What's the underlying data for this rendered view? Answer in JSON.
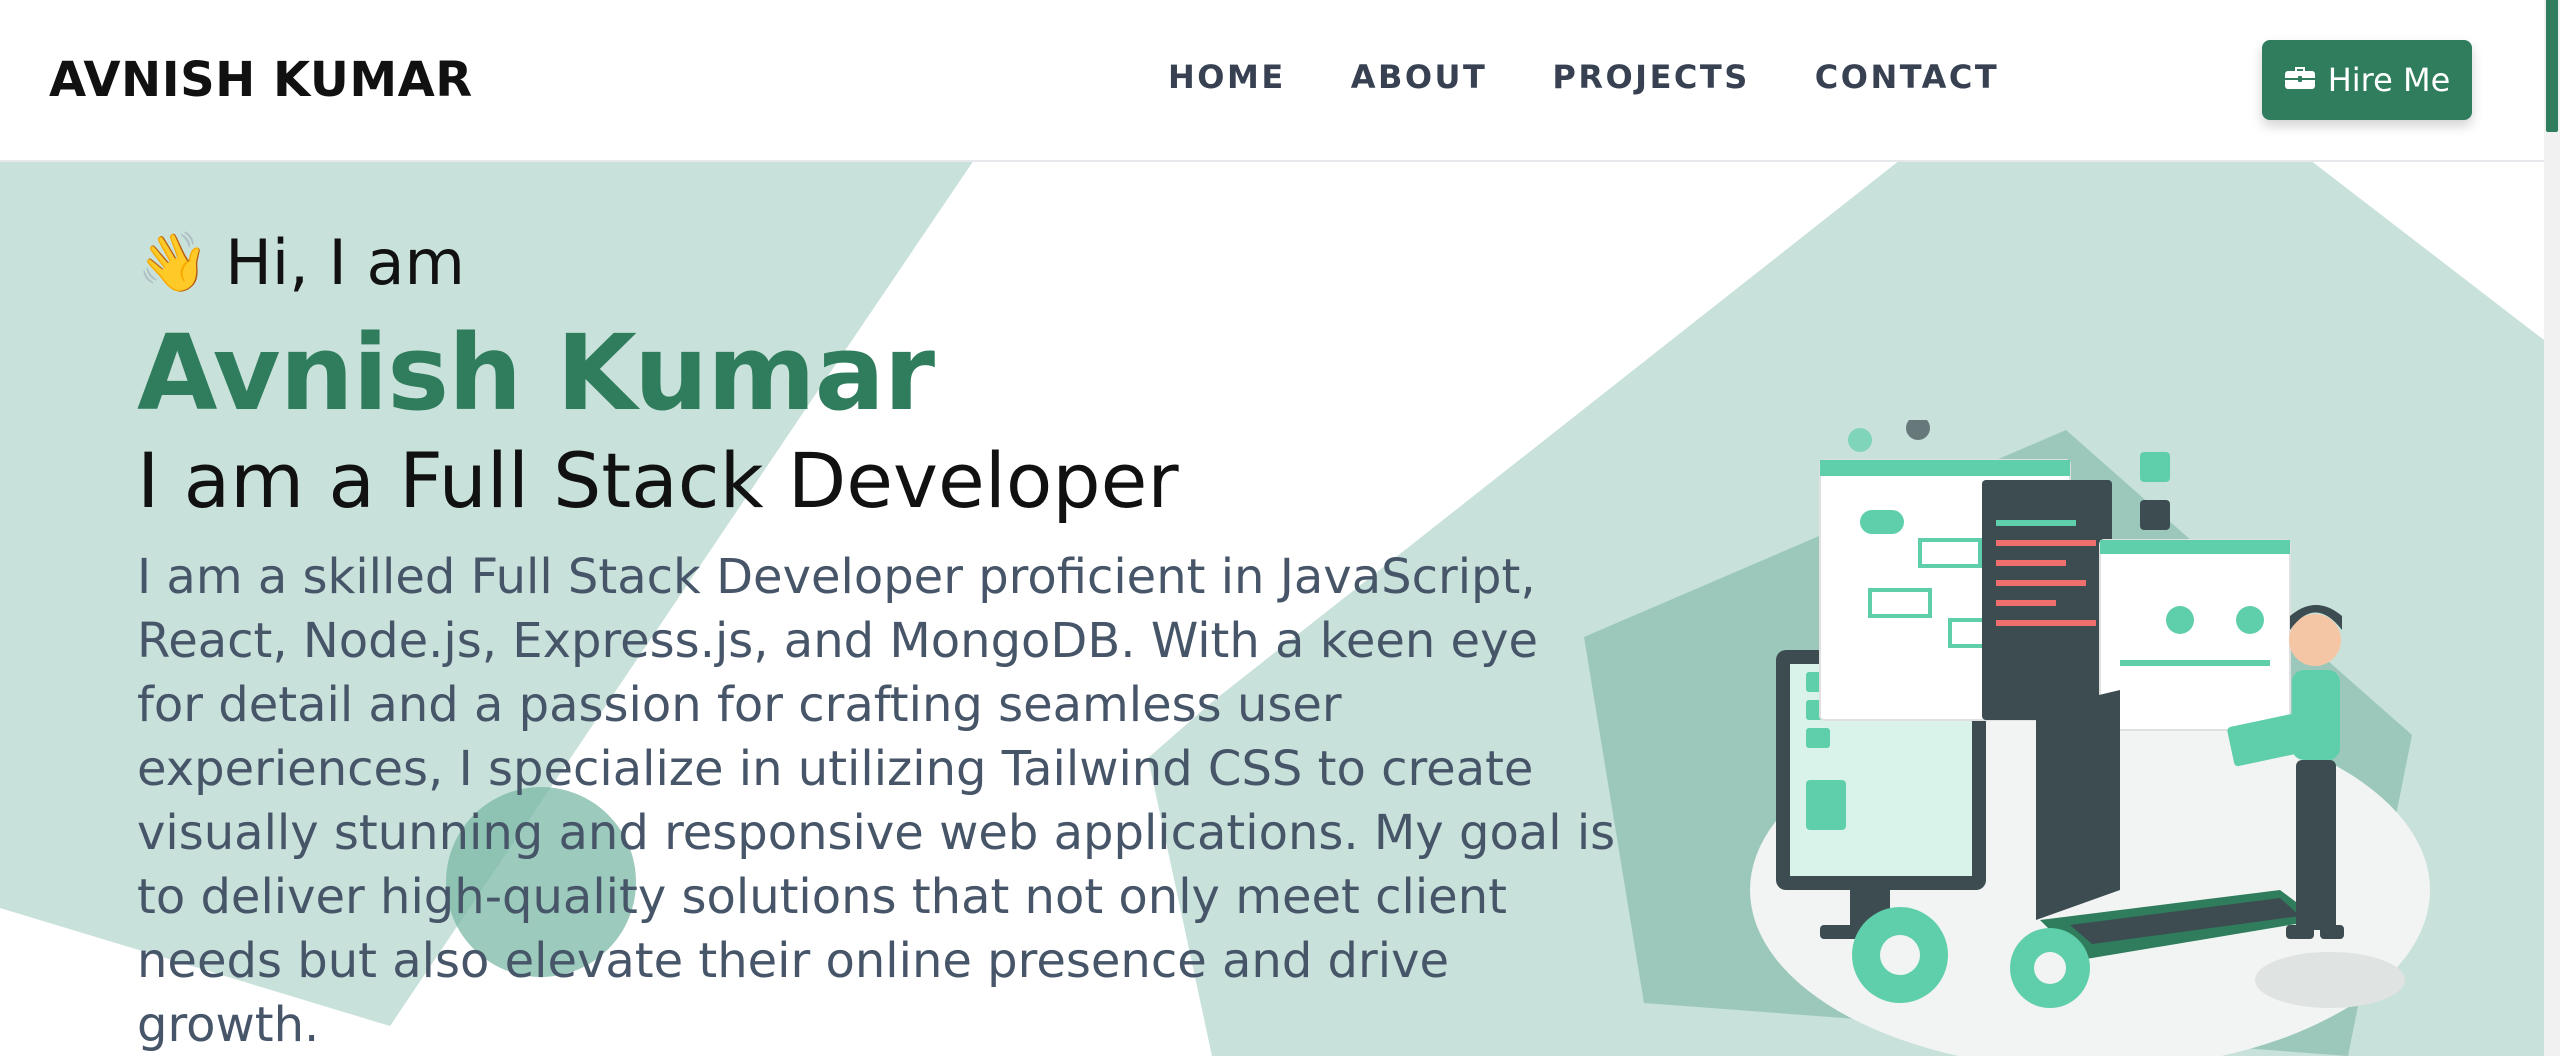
{
  "header": {
    "logo": "AVNISH KUMAR",
    "nav": [
      "HOME",
      "ABOUT",
      "PROJECTS",
      "CONTACT"
    ],
    "hire_label": "Hire Me",
    "hire_icon": "briefcase-icon"
  },
  "hero": {
    "greeting_emoji": "👋",
    "greeting": "Hi, I am",
    "name": "Avnish Kumar",
    "role": "I am a Full Stack Developer",
    "description": "I am a skilled Full Stack Developer proficient in JavaScript, React, Node.js, Express.js, and MongoDB. With a keen eye for detail and a passion for crafting seamless user experiences, I specialize in utilizing Tailwind CSS to create visually stunning and responsive web applications. My goal is to deliver high-quality solutions that not only meet client needs but also elevate their online presence and drive growth."
  },
  "colors": {
    "accent": "#2f7d5c",
    "shape_light": "#c8e1da",
    "shape_mid": "#9cc8bb",
    "illustration_mint": "#5fcfab"
  }
}
